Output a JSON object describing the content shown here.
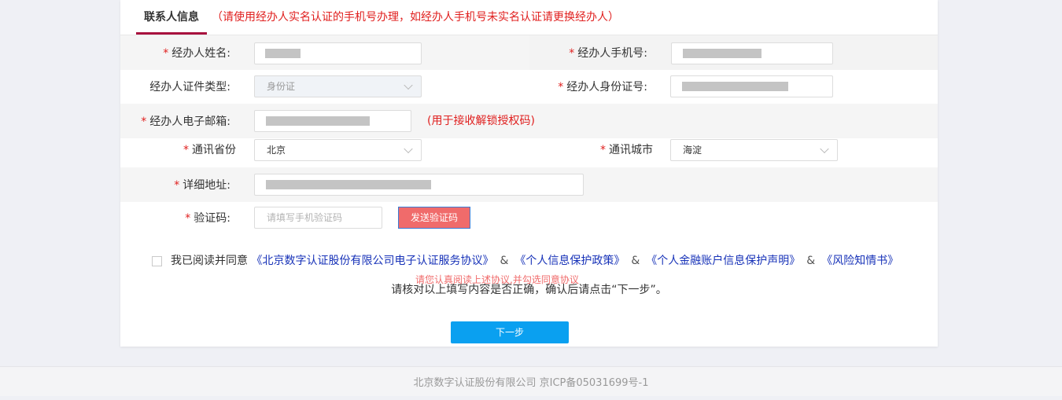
{
  "tab": {
    "title": "联系人信息",
    "note": "（请使用经办人实名认证的手机号办理，如经办人手机号未实名认证请更换经办人）"
  },
  "form": {
    "name_label": "经办人姓名:",
    "phone_label": "经办人手机号:",
    "id_type_label": "经办人证件类型:",
    "id_type_value": "身份证",
    "id_number_label": "经办人身份证号:",
    "email_label": "经办人电子邮箱:",
    "email_note": "(用于接收解锁授权码)",
    "province_label": "通讯省份",
    "province_value": "北京",
    "city_label": "通讯城市",
    "city_value": "海淀",
    "address_label": "详细地址:",
    "code_label": "验证码:",
    "code_placeholder": "请填写手机验证码",
    "send_code_button": "发送验证码",
    "required_mark": "*"
  },
  "agreement": {
    "prefix": "我已阅读并同意",
    "links": [
      "《北京数字认证股份有限公司电子认证服务协议》",
      "《个人信息保护政策》",
      "《个人金融账户信息保护声明》",
      "《风险知情书》"
    ],
    "separator": "&",
    "error": "请您认真阅读上述协议,并勾选同意协议"
  },
  "confirm_text": "请核对以上填写内容是否正确，确认后请点击“下一步”。",
  "next_button": "下一步",
  "footer": "北京数字认证股份有限公司 京ICP备05031699号-1",
  "colors": {
    "required": "#e0201f",
    "tab_underline": "#a8123e",
    "send_button": "#f06b6b",
    "next_button": "#0aa0f0",
    "link": "#1732b8"
  }
}
